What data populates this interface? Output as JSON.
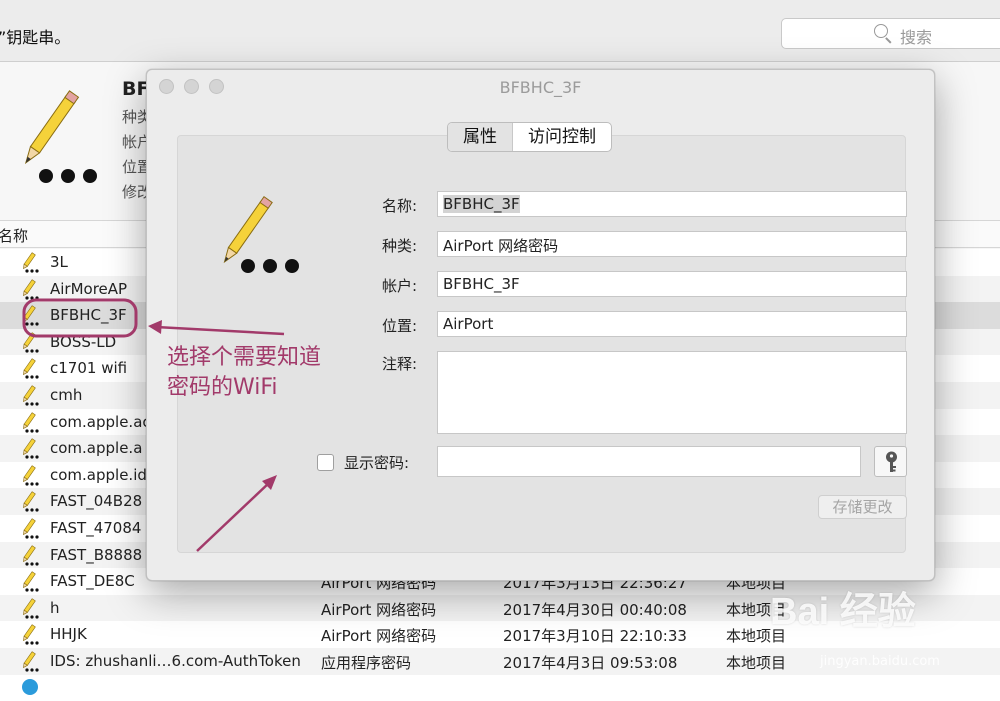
{
  "background": {
    "hint_text": "”钥匙串。",
    "search_placeholder": "搜索",
    "detail": {
      "title": "BF",
      "meta_lines": [
        "种类",
        "帐户",
        "位置",
        "修改"
      ]
    },
    "column_header": "名称",
    "rows": [
      {
        "name": "3L",
        "kind": "",
        "date": "",
        "loc": ""
      },
      {
        "name": "AirMoreAP",
        "kind": "",
        "date": "",
        "loc": ""
      },
      {
        "name": "BFBHC_3F",
        "kind": "",
        "date": "",
        "loc": "",
        "selected": true
      },
      {
        "name": "BOSS-LD",
        "kind": "",
        "date": "",
        "loc": ""
      },
      {
        "name": "c1701 wifi",
        "kind": "",
        "date": "",
        "loc": ""
      },
      {
        "name": "cmh",
        "kind": "",
        "date": "",
        "loc": ""
      },
      {
        "name": "com.apple.ac",
        "kind": "",
        "date": "",
        "loc": ""
      },
      {
        "name": "com.apple.a",
        "kind": "",
        "date": "",
        "loc": ""
      },
      {
        "name": "com.apple.id",
        "kind": "",
        "date": "",
        "loc": ""
      },
      {
        "name": "FAST_04B28",
        "kind": "",
        "date": "",
        "loc": ""
      },
      {
        "name": "FAST_47084",
        "kind": "",
        "date": "",
        "loc": ""
      },
      {
        "name": "FAST_B8888",
        "kind": "",
        "date": "",
        "loc": ""
      },
      {
        "name": "FAST_DE8C",
        "kind": "AirPort 网络密码",
        "date": "2017年3月13日 22:36:27",
        "loc": "本地项目"
      },
      {
        "name": "h",
        "kind": "AirPort 网络密码",
        "date": "2017年4月30日 00:40:08",
        "loc": "本地项目"
      },
      {
        "name": "HHJK",
        "kind": "AirPort 网络密码",
        "date": "2017年3月10日 22:10:33",
        "loc": "本地项目"
      },
      {
        "name": "IDS: zhushanli…6.com-AuthToken",
        "kind": "应用程序密码",
        "date": "2017年4月3日 09:53:08",
        "loc": "本地项目"
      },
      {
        "name": "",
        "kind": "",
        "date": "",
        "loc": "",
        "blue": true
      }
    ]
  },
  "modal": {
    "title": "BFBHC_3F",
    "tabs": [
      {
        "label": "属性",
        "active": true
      },
      {
        "label": "访问控制",
        "active": false
      }
    ],
    "fields": {
      "name_label": "名称:",
      "name_value": "BFBHC_3F",
      "kind_label": "种类:",
      "kind_value": "AirPort 网络密码",
      "account_label": "帐户:",
      "account_value": "BFBHC_3F",
      "location_label": "位置:",
      "location_value": "AirPort",
      "comment_label": "注释:",
      "comment_value": ""
    },
    "show_password_label": "显示密码:",
    "password_value": "",
    "save_button": "存储更改"
  },
  "annotation": {
    "line1": "选择个需要知道",
    "line2": "密码的WiFi",
    "color": "#a23a6a"
  },
  "watermark": {
    "brand": "Bai 经验",
    "url": "jingyan.baidu.com"
  }
}
